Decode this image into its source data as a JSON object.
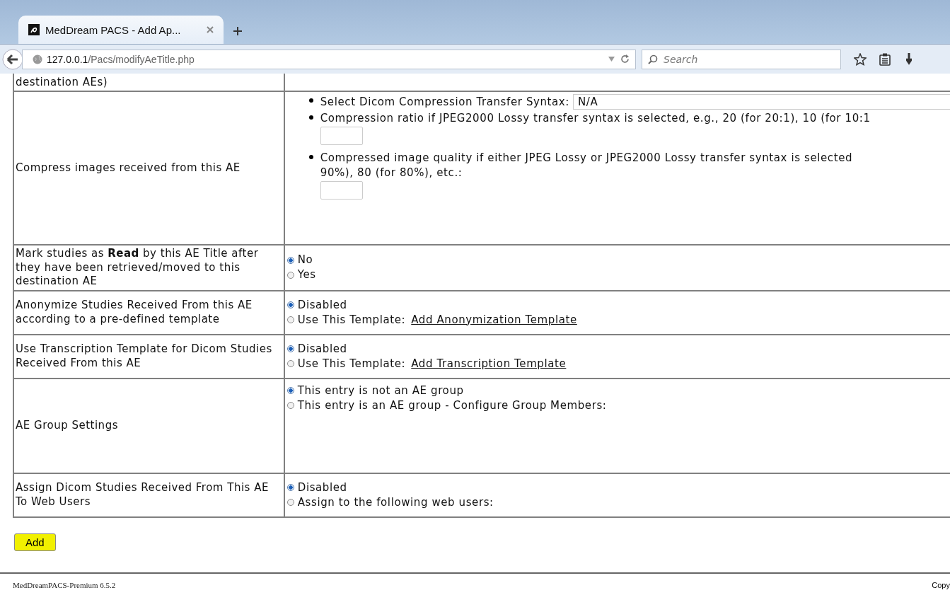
{
  "browser": {
    "tabs": [
      {
        "title": "MedDream PACS - Add Ap...",
        "selected": true
      }
    ],
    "url_host": "127.0.0.1",
    "url_path": "/Pacs/modifyAeTitle.php",
    "search": {
      "placeholder": "Search"
    }
  },
  "table": {
    "rows": [
      {
        "kind": "partial",
        "label": "destination AEs)"
      },
      {
        "kind": "compression",
        "label": "Compress images received from this AE",
        "items": [
          {
            "kind": "select",
            "text": "Select Dicom Compression Transfer Syntax:",
            "value": "N/A"
          },
          {
            "kind": "input",
            "lines": [
              "Compression ratio if JPEG2000 Lossy transfer syntax is selected, e.g., 20 (for 20:1), 10 (for 10:1"
            ]
          },
          {
            "kind": "input",
            "lines": [
              "Compressed image quality if either JPEG Lossy or JPEG2000 Lossy transfer syntax is selected",
              "90%), 80 (for 80%), etc.:"
            ]
          }
        ]
      },
      {
        "kind": "radio",
        "label": "Mark studies as **Read** by this AE Title after they have been retrieved/moved to this destination AE",
        "options": [
          {
            "text": "No",
            "selected": true
          },
          {
            "text": "Yes",
            "selected": false
          }
        ]
      },
      {
        "kind": "radio",
        "label": "Anonymize Studies Received From this AE according to a pre-defined template",
        "options": [
          {
            "text": "Disabled",
            "selected": true
          },
          {
            "text": "Use This Template:",
            "link": "Add Anonymization Template",
            "selected": false
          }
        ]
      },
      {
        "kind": "radio",
        "label": "Use Transcription Template for Dicom Studies Received From this AE",
        "options": [
          {
            "text": "Disabled",
            "selected": true
          },
          {
            "text": "Use This Template:",
            "link": "Add Transcription Template",
            "selected": false
          }
        ]
      },
      {
        "kind": "radio",
        "tall": true,
        "label": "AE Group Settings",
        "options": [
          {
            "text": "This entry is not an AE group",
            "selected": true
          },
          {
            "text": "This entry is an AE group - Configure Group Members:",
            "selected": false
          }
        ]
      },
      {
        "kind": "radio",
        "label": "Assign Dicom Studies Received From This AE To Web Users",
        "options": [
          {
            "text": "Disabled",
            "selected": true
          },
          {
            "text": "Assign to the following web users:",
            "selected": false
          }
        ]
      }
    ]
  },
  "add_button": "Add",
  "footer": {
    "version": "MedDreamPACS-Premium 6.5.2",
    "right": "Copy"
  }
}
